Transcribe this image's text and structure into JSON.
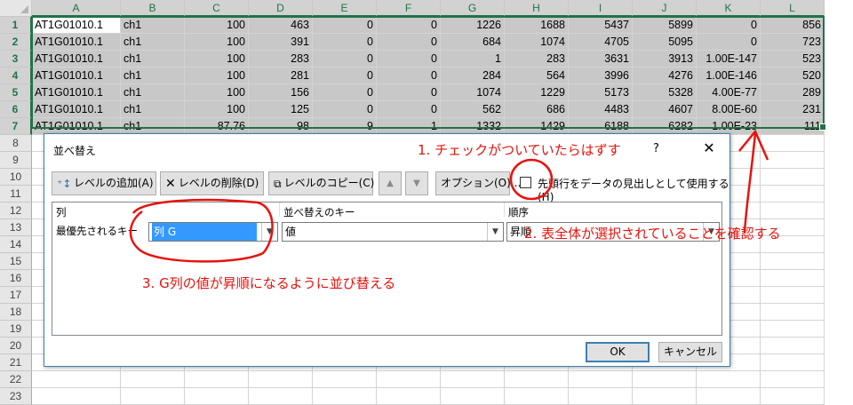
{
  "columns": [
    "A",
    "B",
    "C",
    "D",
    "E",
    "F",
    "G",
    "H",
    "I",
    "J",
    "K",
    "L"
  ],
  "rows": [
    "1",
    "2",
    "3",
    "4",
    "5",
    "6",
    "7",
    "8",
    "9",
    "10",
    "11",
    "12",
    "13",
    "14",
    "15",
    "16",
    "17",
    "18",
    "19",
    "20",
    "21",
    "22",
    "23"
  ],
  "cells": [
    [
      "AT1G01010.1",
      "ch1",
      "100",
      "463",
      "0",
      "0",
      "1226",
      "1688",
      "5437",
      "5899",
      "0",
      "856"
    ],
    [
      "AT1G01010.1",
      "ch1",
      "100",
      "391",
      "0",
      "0",
      "684",
      "1074",
      "4705",
      "5095",
      "0",
      "723"
    ],
    [
      "AT1G01010.1",
      "ch1",
      "100",
      "283",
      "0",
      "0",
      "1",
      "283",
      "3631",
      "3913",
      "1.00E-147",
      "523"
    ],
    [
      "AT1G01010.1",
      "ch1",
      "100",
      "281",
      "0",
      "0",
      "284",
      "564",
      "3996",
      "4276",
      "1.00E-146",
      "520"
    ],
    [
      "AT1G01010.1",
      "ch1",
      "100",
      "156",
      "0",
      "0",
      "1074",
      "1229",
      "5173",
      "5328",
      "4.00E-77",
      "289"
    ],
    [
      "AT1G01010.1",
      "ch1",
      "100",
      "125",
      "0",
      "0",
      "562",
      "686",
      "4483",
      "4607",
      "8.00E-60",
      "231"
    ],
    [
      "AT1G01010.1",
      "ch1",
      "87.76",
      "98",
      "9",
      "1",
      "1332",
      "1429",
      "6188",
      "6282",
      "1.00E-23",
      "111"
    ]
  ],
  "dialog": {
    "title": "並べ替え",
    "help": "?",
    "close": "✕",
    "add_level": "レベルの追加(A)",
    "delete_level": "レベルの削除(D)",
    "copy_level": "レベルのコピー(C)",
    "move_up": "▲",
    "move_down": "▼",
    "options": "オプション(O)...",
    "header_checkbox_label": "先頭行をデータの見出しとして使用する(H)",
    "header_checked": false,
    "col_header": "列",
    "key_header": "並べ替えのキー",
    "order_header": "順序",
    "row_label": "最優先されるキー",
    "column_value": "列 G",
    "key_value": "値",
    "order_value": "昇順",
    "ok": "OK",
    "cancel": "キャンセル"
  },
  "annotations": {
    "note1": "1. チェックがついていたらはずす",
    "note2": "2.  表全体が選択されていることを確認する",
    "note3": "3. G列の値が昇順になるように並び替える"
  },
  "colors": {
    "annotation": "#e8120c",
    "selection": "#217346",
    "highlight": "#3399ff"
  }
}
